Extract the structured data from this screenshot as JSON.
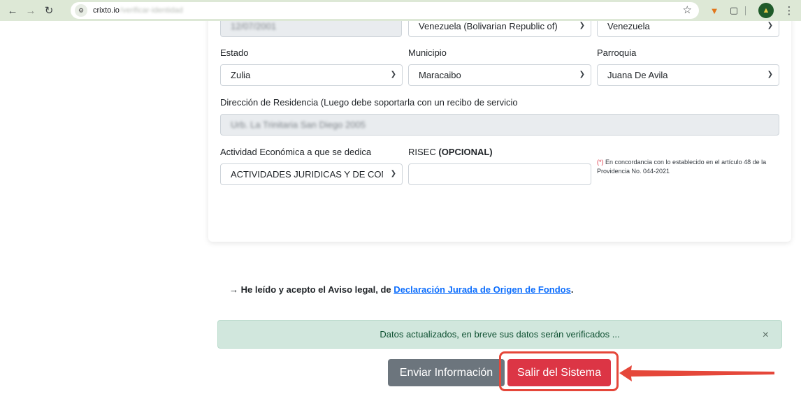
{
  "browser": {
    "url_host": "crixto.io",
    "url_path": "/verificar-identidad",
    "icons": [
      "back-arrow-icon",
      "forward-arrow-icon",
      "reload-icon",
      "site-info-icon",
      "bookmark-star-icon",
      "metamask-fox-icon",
      "extensions-puzzle-icon",
      "profile-avatar-icon",
      "kebab-menu-icon"
    ]
  },
  "form": {
    "row0": {
      "date_value": "12/07/2001",
      "country_value": "Venezuela (Bolivarian Republic of)",
      "nationality_value": "Venezuela"
    },
    "estado": {
      "label": "Estado",
      "value": "Zulia"
    },
    "municipio": {
      "label": "Municipio",
      "value": "Maracaibo"
    },
    "parroquia": {
      "label": "Parroquia",
      "value": "Juana De Avila"
    },
    "direccion": {
      "label": "Dirección de Residencia (Luego debe soportarla con un recibo de servicio",
      "value": "Urb. La Trinitaria San Diego 2005"
    },
    "actividad": {
      "label": "Actividad Económica a que se dedica",
      "value": "ACTIVIDADES JURIDICAS Y DE CONTABILIDAD"
    },
    "risec": {
      "label": "RISEC",
      "label_bold": "(OPCIONAL)",
      "value": ""
    },
    "note": {
      "asterisk": "(*)",
      "text": " En concordancia con lo establecido en el artículo 48 de la Providencia No. 044-2021"
    }
  },
  "legal": {
    "prefix": "→ He leído y acepto el Aviso legal, de ",
    "link": "Declaración Jurada de Origen de Fondos",
    "suffix": "."
  },
  "alert": {
    "message": "Datos actualizados, en breve sus datos serán verificados ...",
    "close": "×"
  },
  "buttons": {
    "send": "Enviar Información",
    "exit": "Salir del Sistema"
  },
  "colors": {
    "primary_link": "#0d6efd",
    "danger": "#dc3545",
    "secondary": "#6c757d",
    "success_bg": "#d1e7dd",
    "annotation": "#e5473a"
  }
}
